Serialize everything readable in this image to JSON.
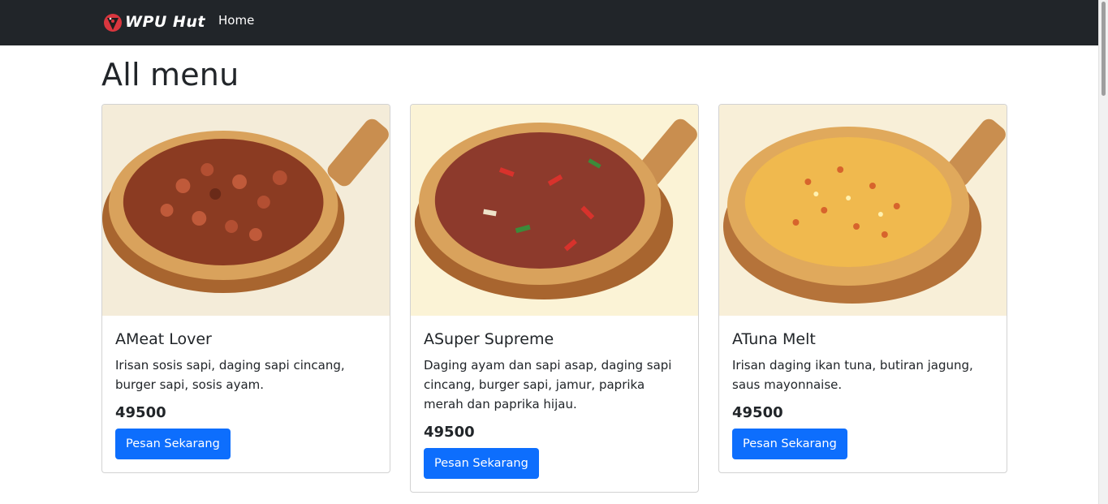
{
  "navbar": {
    "brand": "WPU Hut",
    "links": [
      "Home"
    ]
  },
  "main": {
    "title": "All menu",
    "items": [
      {
        "name": "AMeat Lover",
        "description": "Irisan sosis sapi, daging sapi cincang, burger sapi, sosis ayam.",
        "price": "49500",
        "button_label": "Pesan Sekarang"
      },
      {
        "name": "ASuper Supreme",
        "description": "Daging ayam dan sapi asap, daging sapi cincang, burger sapi, jamur, paprika merah dan paprika hijau.",
        "price": "49500",
        "button_label": "Pesan Sekarang"
      },
      {
        "name": "ATuna Melt",
        "description": "Irisan daging ikan tuna, butiran jagung, saus mayonnaise.",
        "price": "49500",
        "button_label": "Pesan Sekarang"
      }
    ]
  },
  "colors": {
    "navbar_bg": "#212529",
    "primary_button": "#0d6efd",
    "image_bg": "#f6ecd2"
  },
  "icons": {
    "brand": "pizza-logo-icon"
  }
}
